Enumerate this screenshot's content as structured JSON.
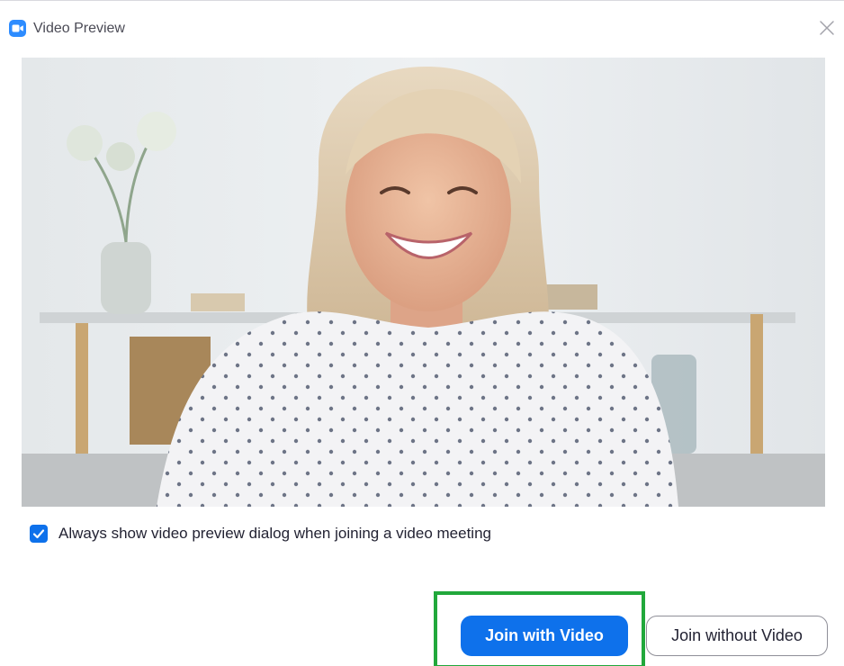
{
  "window": {
    "title": "Video Preview",
    "app_icon": "zoom-camera-icon",
    "close_icon": "close-icon"
  },
  "video": {
    "content": "camera-preview-feed"
  },
  "preferences": {
    "always_show_preview_label": "Always show video preview dialog when joining a video meeting",
    "always_show_preview_checked": true
  },
  "actions": {
    "join_with_video_label": "Join with Video",
    "join_without_video_label": "Join without Video"
  },
  "colors": {
    "accent": "#0e71eb",
    "highlight": "#21a83b",
    "text": "#232333"
  }
}
